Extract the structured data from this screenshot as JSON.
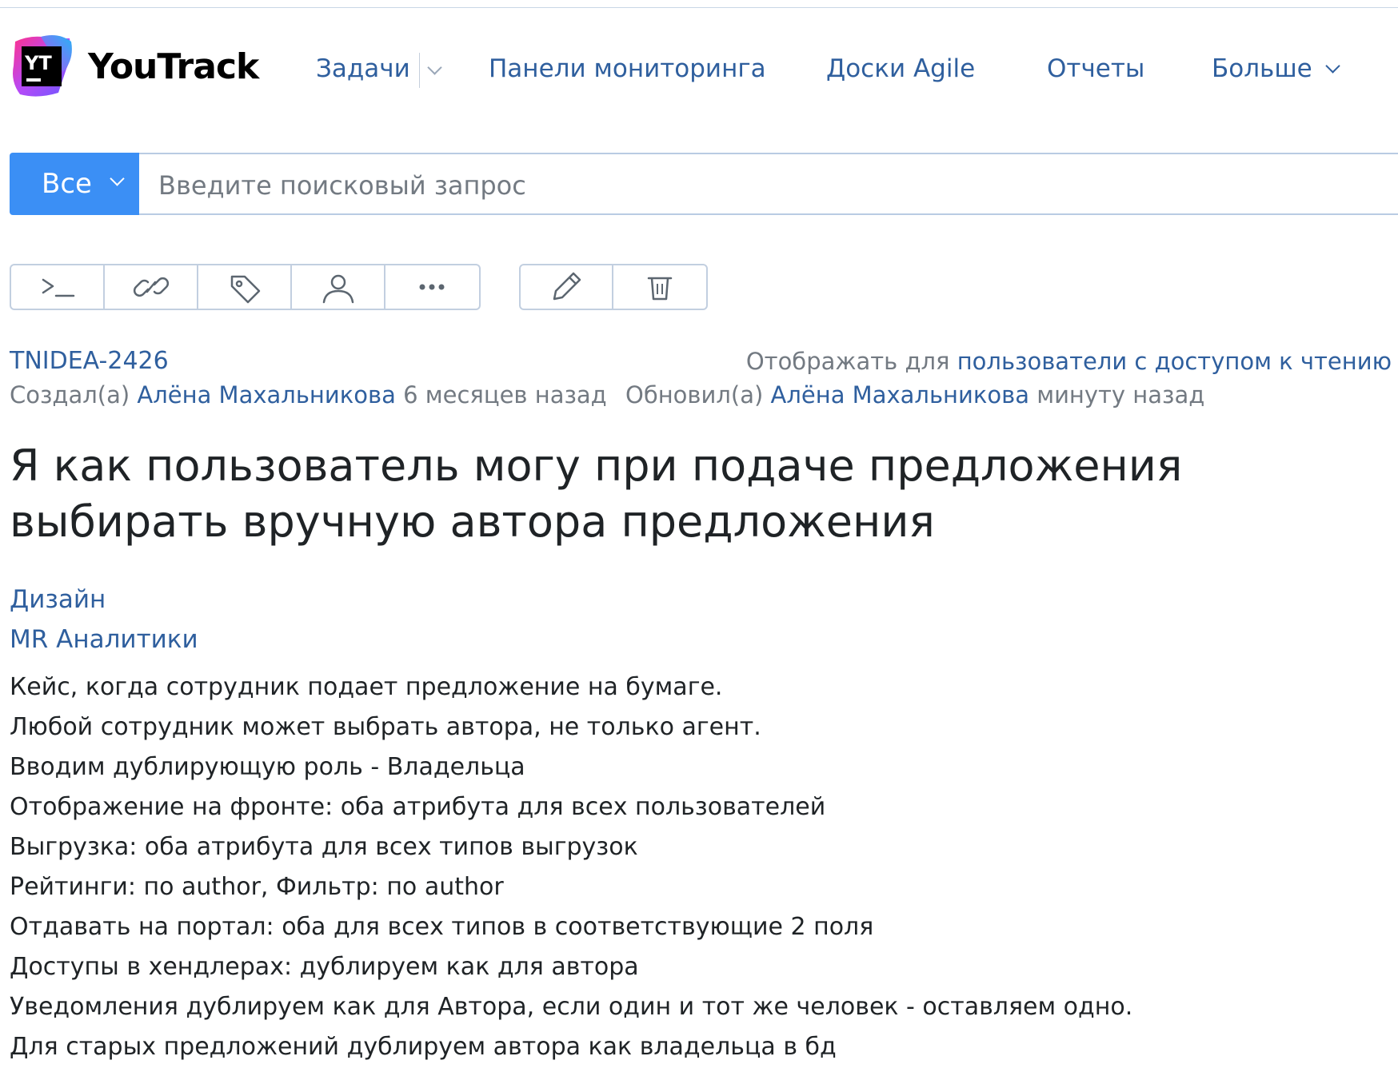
{
  "app": {
    "brand": "YouTrack",
    "logo_text": "YT"
  },
  "nav": {
    "issues": "Задачи",
    "dashboards": "Панели мониторинга",
    "agile_boards": "Доски Agile",
    "reports": "Отчеты",
    "more": "Больше"
  },
  "search": {
    "context_label": "Все",
    "placeholder": "Введите поисковый запрос",
    "value": ""
  },
  "toolbar": {
    "group1": [
      "terminal-icon",
      "link-icon",
      "tag-icon",
      "user-icon",
      "more-icon"
    ],
    "group2": [
      "pencil-icon",
      "trash-icon"
    ]
  },
  "issue": {
    "id": "TNIDEA-2426",
    "visibility_prefix": "Отображать для",
    "visibility_value": "пользователи с доступом к чтению",
    "created_prefix": "Создал(а)",
    "created_by": "Алёна Махальникова",
    "created_when": "6 месяцев назад",
    "updated_prefix": "Обновил(а)",
    "updated_by": "Алёна Махальникова",
    "updated_when": "минуту назад",
    "title": "Я как пользователь могу при подаче предложения выбирать вручную автора предложения",
    "tags": [
      "Дизайн",
      "MR Аналитики"
    ],
    "description": [
      "Кейс, когда сотрудник подает предложение на бумаге.",
      "Любой сотрудник может выбрать автора, не только агент.",
      "Вводим дублирующую роль - Владельца",
      "Отображение на фронте: оба атрибута для всех пользователей",
      "Выгрузка: оба атрибута для всех типов выгрузок",
      "Рейтинги: по author, Фильтр: по author",
      "Отдавать на портал: оба для всех типов в соответствующие 2 поля",
      "Доступы в хендлерах: дублируем как для автора",
      "Уведомления дублируем как для Автора, если один и тот же человек - оставляем одно.",
      "Для старых предложений дублируем автора как владельца в бд"
    ]
  },
  "colors": {
    "link": "#2f5f9e",
    "accent": "#3b8ff5",
    "muted": "#737a82",
    "text": "#1f2326",
    "border": "#c2cfe0"
  }
}
